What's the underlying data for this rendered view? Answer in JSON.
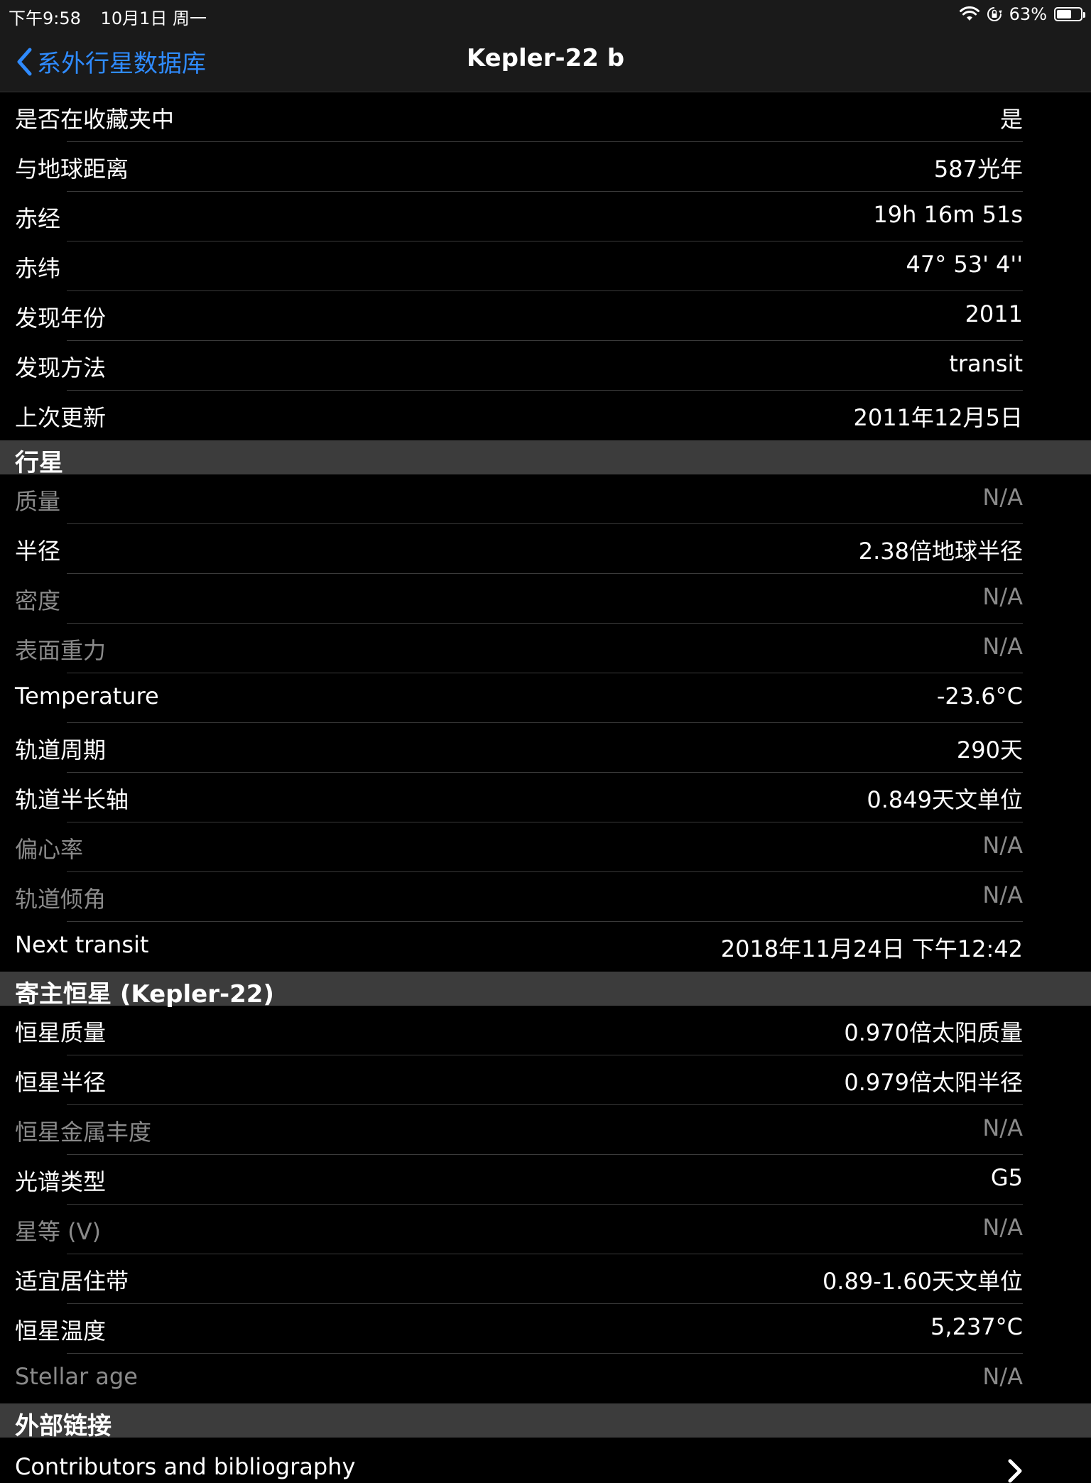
{
  "status_bar": {
    "time": "下午9:58",
    "date": "10月1日 周一",
    "battery": "63%",
    "battery_level": 63,
    "icons": [
      "wifi-icon",
      "rotation-lock-icon",
      "battery-icon"
    ]
  },
  "nav": {
    "back_label": "系外行星数据库",
    "title": "Kepler-22 b"
  },
  "general": [
    {
      "label": "是否在收藏夹中",
      "value": "是",
      "dim": false
    },
    {
      "label": "与地球距离",
      "value": "587光年",
      "dim": false
    },
    {
      "label": "赤经",
      "value": "19h 16m 51s",
      "dim": false
    },
    {
      "label": "赤纬",
      "value": "47° 53' 4''",
      "dim": false
    },
    {
      "label": "发现年份",
      "value": "2011",
      "dim": false
    },
    {
      "label": "发现方法",
      "value": "transit",
      "dim": false
    },
    {
      "label": "上次更新",
      "value": "2011年12月5日",
      "dim": false
    }
  ],
  "planet_section": {
    "title": "行星",
    "rows": [
      {
        "label": "质量",
        "value": "N/A",
        "dim": true
      },
      {
        "label": "半径",
        "value": "2.38倍地球半径",
        "dim": false
      },
      {
        "label": "密度",
        "value": "N/A",
        "dim": true
      },
      {
        "label": "表面重力",
        "value": "N/A",
        "dim": true
      },
      {
        "label": "Temperature",
        "value": "-23.6°C",
        "dim": false
      },
      {
        "label": "轨道周期",
        "value": "290天",
        "dim": false
      },
      {
        "label": "轨道半长轴",
        "value": "0.849天文单位",
        "dim": false
      },
      {
        "label": "偏心率",
        "value": "N/A",
        "dim": true
      },
      {
        "label": "轨道倾角",
        "value": "N/A",
        "dim": true
      },
      {
        "label": "Next transit",
        "value": "2018年11月24日 下午12:42",
        "dim": false
      }
    ]
  },
  "star_section": {
    "title": "寄主恒星 (Kepler-22)",
    "rows": [
      {
        "label": "恒星质量",
        "value": "0.970倍太阳质量",
        "dim": false
      },
      {
        "label": "恒星半径",
        "value": "0.979倍太阳半径",
        "dim": false
      },
      {
        "label": "恒星金属丰度",
        "value": "N/A",
        "dim": true
      },
      {
        "label": "光谱类型",
        "value": "G5",
        "dim": false
      },
      {
        "label": "星等 (V)",
        "value": "N/A",
        "dim": true
      },
      {
        "label": "适宜居住带",
        "value": "0.89-1.60天文单位",
        "dim": false
      },
      {
        "label": "恒星温度",
        "value": "5,237°C",
        "dim": false
      },
      {
        "label": "Stellar age",
        "value": "N/A",
        "dim": true
      }
    ]
  },
  "links_section": {
    "title": "外部链接",
    "rows": [
      {
        "label": "Contributors and bibliography"
      }
    ]
  }
}
